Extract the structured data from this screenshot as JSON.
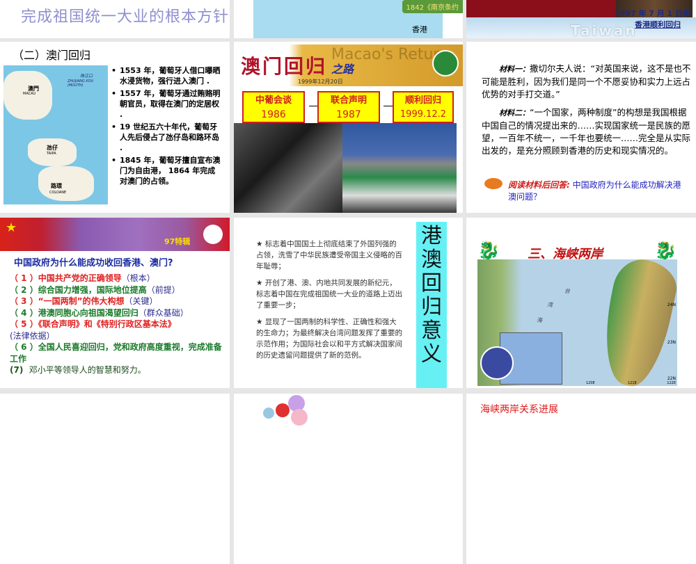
{
  "slide_title_top": "完成祖国统一大业的根本方针",
  "slide_treaty_map": {
    "treaty_label": "1842《南京条约",
    "place_label": "香港"
  },
  "slide_hk_return": {
    "date": "1997 年 7 月 1 日年",
    "caption": "香港顺利回归",
    "watermark": "Taiwan"
  },
  "slide_macau": {
    "heading": "（二）澳门回归",
    "map_labels": [
      "澳門",
      "MACAU",
      "珠江口",
      "ZHUJIANG KOU (MOUTH)",
      "氹仔",
      "TAIPA",
      "路環",
      "COLOANE"
    ],
    "bullets": [
      "1553 年，葡萄牙人借口曝晒水浸货物，强行进入澳门 .",
      "1557 年，葡萄牙通过贿赂明朝官员，取得在澳门的定居权 .",
      "19 世纪五六十年代，葡萄牙人先后侵占了氹仔岛和路环岛 .",
      "1845 年，葡萄牙擅自宣布澳门为自由港， 1864 年完成对澳门的占领。"
    ]
  },
  "slide_macau_road": {
    "title": "澳门回归",
    "title_suffix": "之路",
    "watermark": "Macao's Return",
    "date": "1999年12月20日",
    "steps": [
      {
        "label": "中葡会谈",
        "year": "1986"
      },
      {
        "label": "联合声明",
        "year": "1987"
      },
      {
        "label": "顺利回归",
        "year": "1999.12.2"
      }
    ]
  },
  "slide_materials": {
    "m1_label": "材料一：",
    "m1_text": "撒切尔夫人说：“对英国来说，这不是也不可能是胜利，因为我们是同一个不愿妥协和实力上远占优势的对手打交道。”",
    "m2_label": "材料二：",
    "m2_text": "“一个国家，两种制度”的构想是我国根据中国自己的情况提出来的……实现国家统一是民族的愿望，一百年不统一，一千年也要统一……完全是从实际出发的，是充分照顾到香港的历史和现实情况的。",
    "question_label": "阅读材料后回答:",
    "question": "中国政府为什么能成功解决港澳问题？"
  },
  "slide_reasons": {
    "banner_tag": "97特辑",
    "question": "中国政府为什么能成功收回香港、澳门?",
    "items": [
      {
        "num": "（ 1 ）",
        "text": "中国共产党的正确领导",
        "note": "（根本）"
      },
      {
        "num": "（ 2 ）",
        "text": "综合国力增强，国际地位提高",
        "note": "（前提）"
      },
      {
        "num": "（ 3 ）",
        "text": "“一国两制”的伟大构想",
        "note": "（关键）"
      },
      {
        "num": "（ 4 ）",
        "text": "港澳同胞心向祖国渴望回归",
        "note": "（群众基础）"
      },
      {
        "num": "（ 5 ）",
        "text": "《联合声明》和《特别行政区基本法》",
        "note": "(法律依据）"
      },
      {
        "num": "（ 6 ）",
        "text": "全国人民喜迎回归，党和政府高度重视，完成准备工作",
        "note": ""
      },
      {
        "num": "(7)",
        "text": "邓小平等领导人的智慧和努力。",
        "note": ""
      }
    ]
  },
  "slide_significance": {
    "vertical_title": "港澳回归意义",
    "points": [
      "★ 标志着中国国土上彻底结束了外国列强的占领，洗雪了中华民族遭受帝国主义侵略的百年耻辱；",
      "★ 开创了港、澳、内地共同发展的新纪元，标志着中国在完成祖国统一大业的道路上迈出了重要一步；",
      "★ 显现了一国两制的科学性、正确性和强大的生命力；为最终解决台湾问题发挥了重要的示范作用；为国际社会以和平方式解决国家间的历史遗留问题提供了新的范例。"
    ]
  },
  "slide_strait": {
    "title": "三、海峡两岸",
    "map_labels": [
      "台",
      "湾",
      "海",
      "24N",
      "23N",
      "22N",
      "120E",
      "121E",
      "122E"
    ]
  },
  "slide_progress": {
    "title": "海峡两岸关系进展"
  }
}
